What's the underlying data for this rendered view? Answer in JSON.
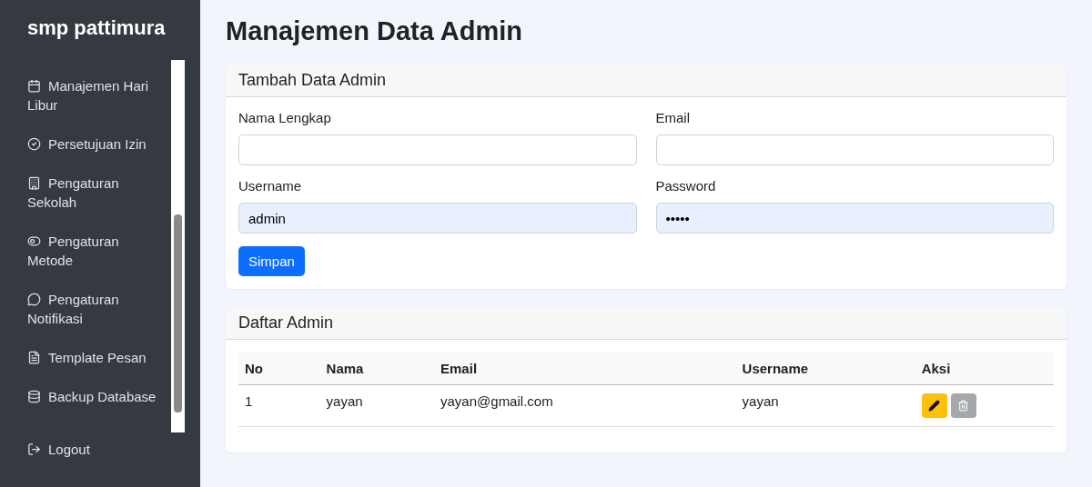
{
  "sidebar": {
    "brand": "smp pattimura",
    "items": [
      {
        "kind": "calendar",
        "label": "Manajemen Hari Libur"
      },
      {
        "kind": "check",
        "label": "Persetujuan Izin"
      },
      {
        "kind": "building",
        "label": "Pengaturan Sekolah"
      },
      {
        "kind": "toggle",
        "label": "Pengaturan Metode"
      },
      {
        "kind": "chat",
        "label": "Pengaturan Notifikasi"
      },
      {
        "kind": "document",
        "label": "Template Pesan"
      },
      {
        "kind": "database",
        "label": "Backup Database"
      }
    ],
    "logout": "Logout"
  },
  "page_title": "Manajemen Data Admin",
  "form": {
    "title": "Tambah Data Admin",
    "fields": [
      {
        "label": "Nama Lengkap",
        "autofilled": false
      },
      {
        "label": "Email",
        "autofilled": false
      },
      {
        "label": "Username",
        "value": "admin",
        "autofilled": true
      },
      {
        "label": "Password",
        "value": "•••••",
        "autofilled": true
      }
    ],
    "submit": "Simpan"
  },
  "table": {
    "title": "Daftar Admin",
    "columns": [
      "No",
      "Nama",
      "Email",
      "Username",
      "Aksi"
    ],
    "rows": [
      {
        "cells": [
          "1",
          "yayan",
          "yayan@gmail.com",
          "yayan"
        ]
      }
    ]
  }
}
